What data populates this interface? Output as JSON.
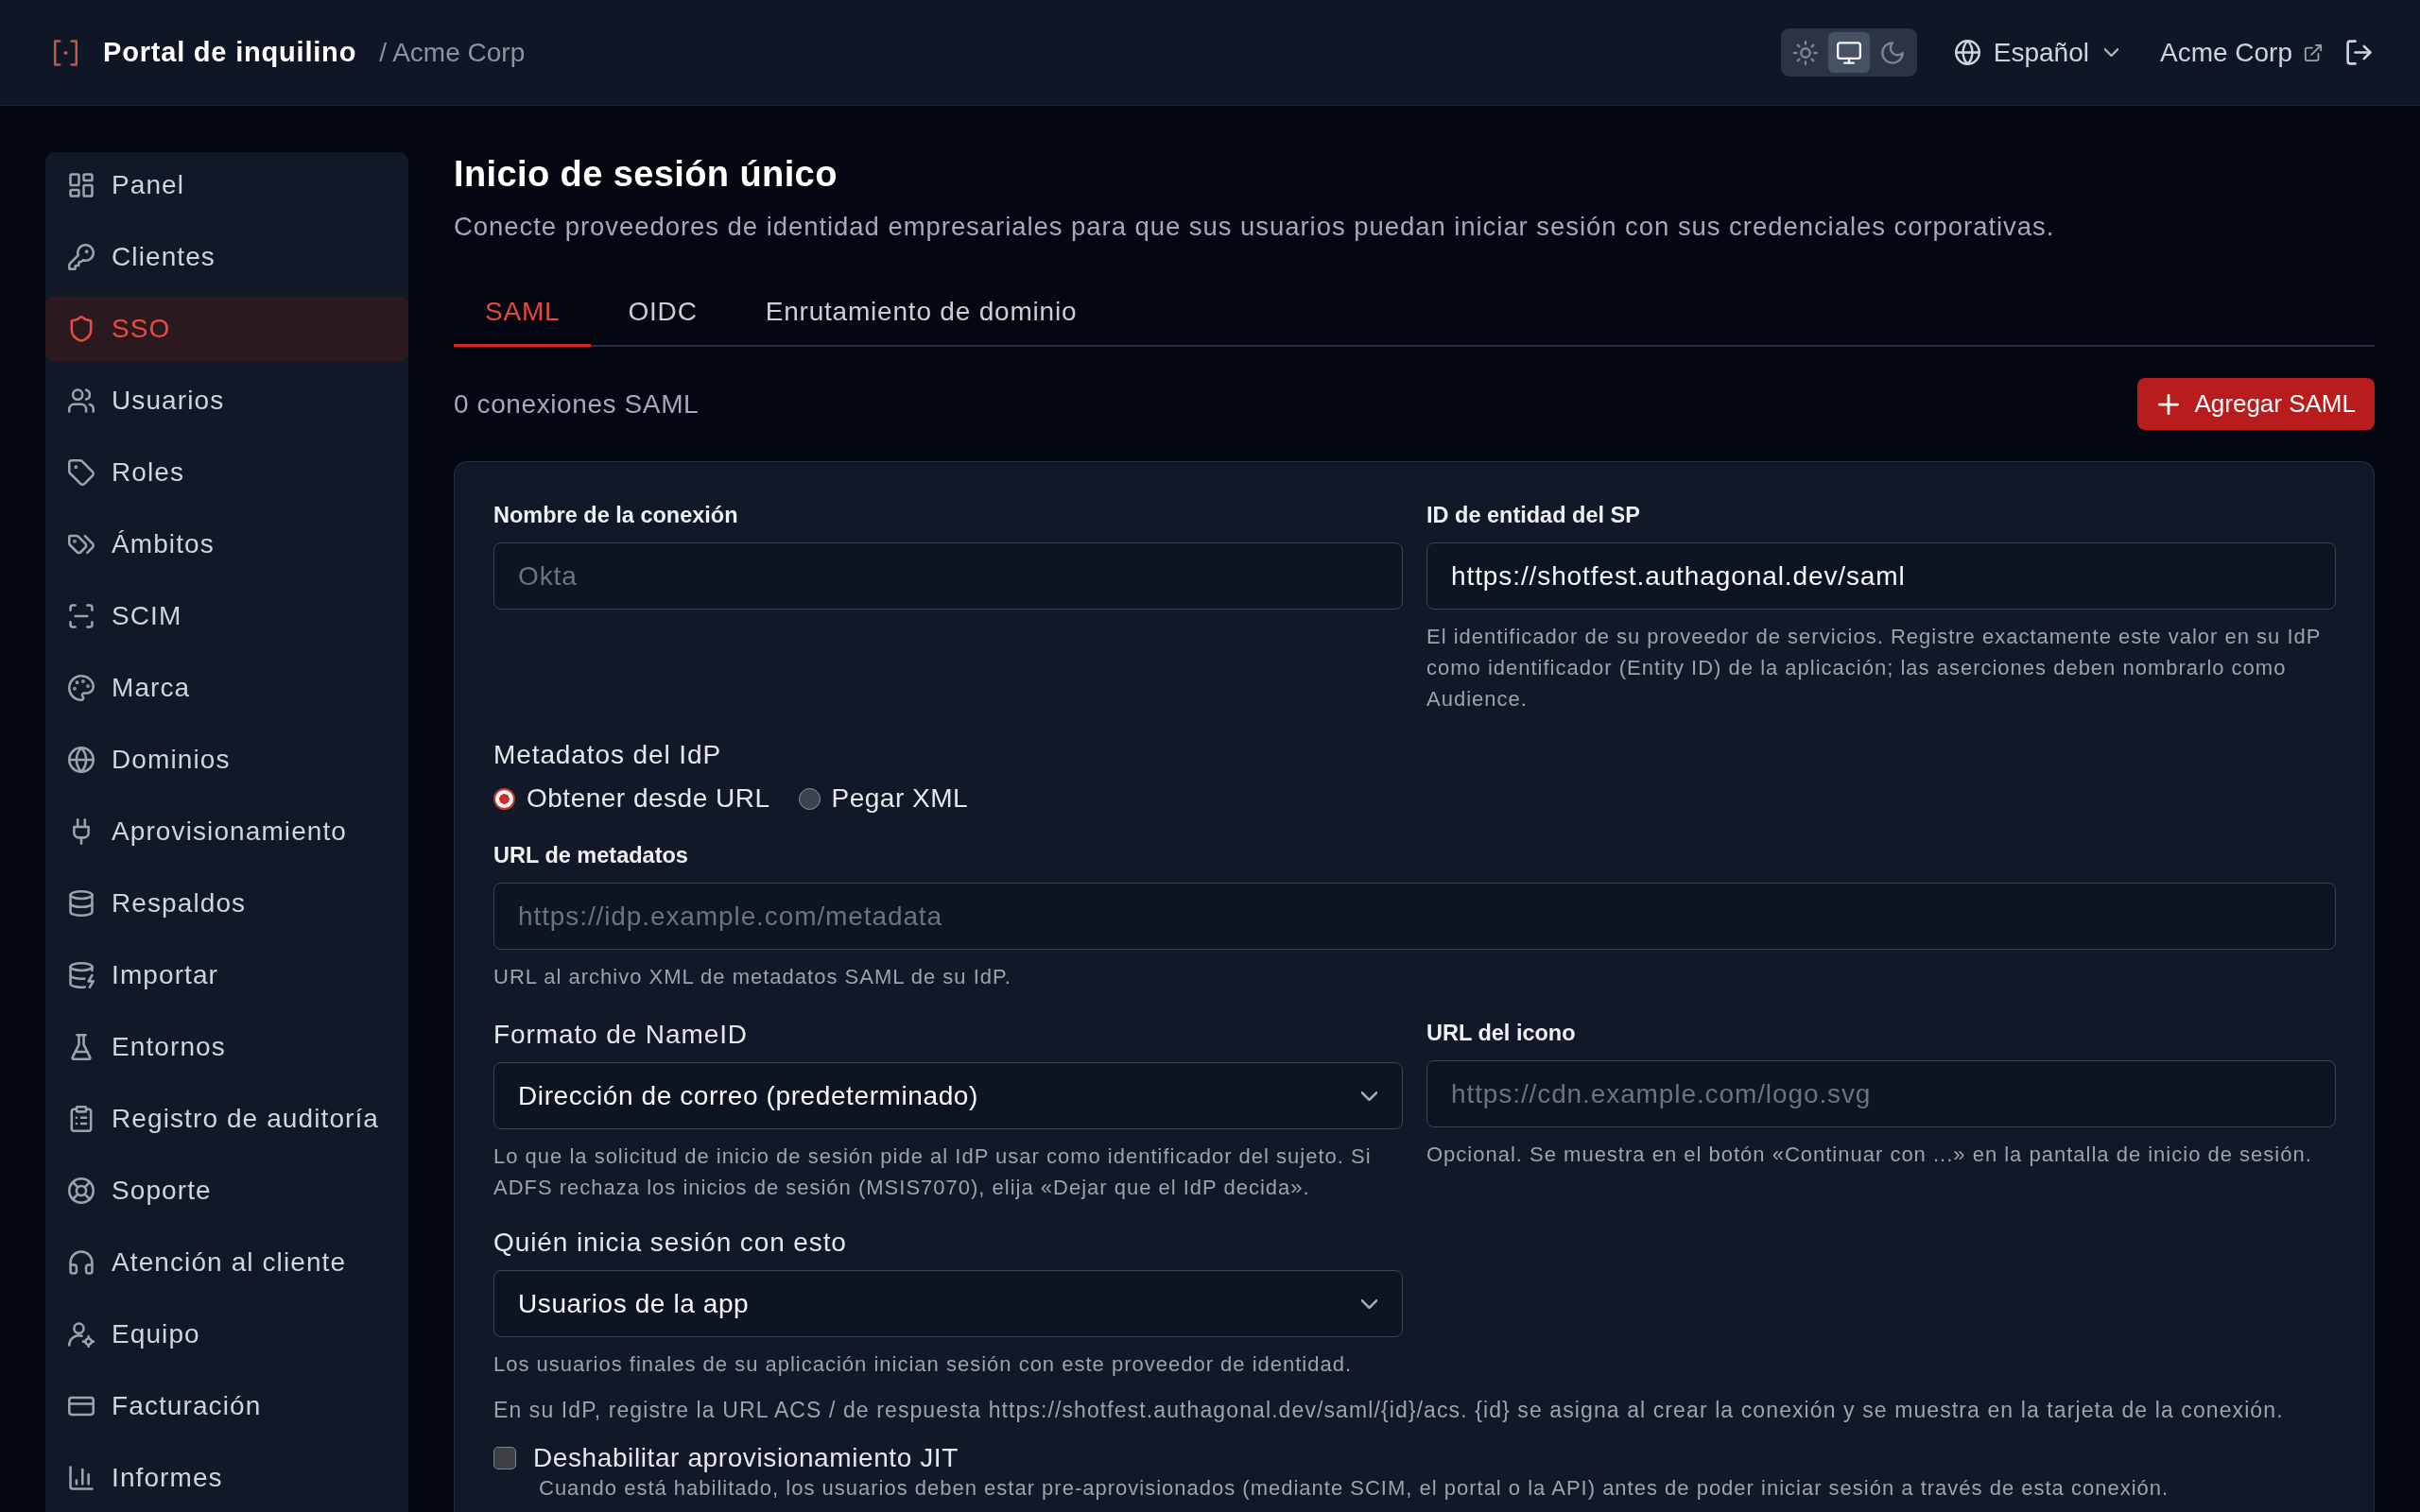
{
  "header": {
    "brand": "Portal de inquilino",
    "tenant": "/ Acme Corp",
    "theme_modes": [
      {
        "selected": false
      },
      {
        "selected": true
      },
      {
        "selected": false
      }
    ],
    "language": "Español",
    "account": "Acme Corp"
  },
  "sidebar": {
    "items": [
      {
        "label": "Panel",
        "selected": false
      },
      {
        "label": "Clientes",
        "selected": false
      },
      {
        "label": "SSO",
        "selected": true
      },
      {
        "label": "Usuarios",
        "selected": false
      },
      {
        "label": "Roles",
        "selected": false
      },
      {
        "label": "Ámbitos",
        "selected": false
      },
      {
        "label": "SCIM",
        "selected": false
      },
      {
        "label": "Marca",
        "selected": false
      },
      {
        "label": "Dominios",
        "selected": false
      },
      {
        "label": "Aprovisionamiento",
        "selected": false
      },
      {
        "label": "Respaldos",
        "selected": false
      },
      {
        "label": "Importar",
        "selected": false
      },
      {
        "label": "Entornos",
        "selected": false
      },
      {
        "label": "Registro de auditoría",
        "selected": false
      },
      {
        "label": "Soporte",
        "selected": false
      },
      {
        "label": "Atención al cliente",
        "selected": false
      },
      {
        "label": "Equipo",
        "selected": false
      },
      {
        "label": "Facturación",
        "selected": false
      },
      {
        "label": "Informes",
        "selected": false
      }
    ]
  },
  "page": {
    "title": "Inicio de sesión único",
    "subtitle": "Conecte proveedores de identidad empresariales para que sus usuarios puedan iniciar sesión con sus credenciales corporativas.",
    "tabs": [
      {
        "label": "SAML",
        "selected": true
      },
      {
        "label": "OIDC",
        "selected": false
      },
      {
        "label": "Enrutamiento de dominio",
        "selected": false
      }
    ],
    "connection_count": "0 conexiones SAML",
    "add_button": "Agregar SAML",
    "form": {
      "connection_name": {
        "label": "Nombre de la conexión",
        "placeholder": "Okta"
      },
      "sp_entity_id": {
        "label": "ID de entidad del SP",
        "value": "https://shotfest.authagonal.dev/saml",
        "help": "El identificador de su proveedor de servicios. Registre exactamente este valor en su IdP como identificador (Entity ID) de la aplicación; las aserciones deben nombrarlo como Audience."
      },
      "idp_metadata": {
        "label": "Metadatos del IdP",
        "options": [
          {
            "label": "Obtener desde URL",
            "selected": true
          },
          {
            "label": "Pegar XML",
            "selected": false
          }
        ]
      },
      "metadata_url": {
        "label": "URL de metadatos",
        "placeholder": "https://idp.example.com/metadata",
        "help": "URL al archivo XML de metadatos SAML de su IdP."
      },
      "nameid_format": {
        "label": "Formato de NameID",
        "value": "Dirección de correo (predeterminado)",
        "help": "Lo que la solicitud de inicio de sesión pide al IdP usar como identificador del sujeto. Si ADFS rechaza los inicios de sesión (MSIS7070), elija «Dejar que el IdP decida»."
      },
      "icon_url": {
        "label": "URL del icono",
        "placeholder": "https://cdn.example.com/logo.svg",
        "help": "Opcional. Se muestra en el botón «Continuar con ...» en la pantalla de inicio de sesión."
      },
      "sign_in_audience": {
        "label": "Quién inicia sesión con esto",
        "value": "Usuarios de la app",
        "help": "Los usuarios finales de su aplicación inician sesión con este proveedor de identidad."
      },
      "acs_note": "En su IdP, registre la URL ACS / de respuesta https://shotfest.authagonal.dev/saml/{id}/acs. {id} se asigna al crear la conexión y se muestra en la tarjeta de la conexión.",
      "disable_jit": {
        "label": "Deshabilitar aprovisionamiento JIT",
        "checked": false,
        "help": "Cuando está habilitado, los usuarios deben estar pre-aprovisionados (mediante SCIM, el portal o la API) antes de poder iniciar sesión a través de esta conexión."
      }
    }
  }
}
